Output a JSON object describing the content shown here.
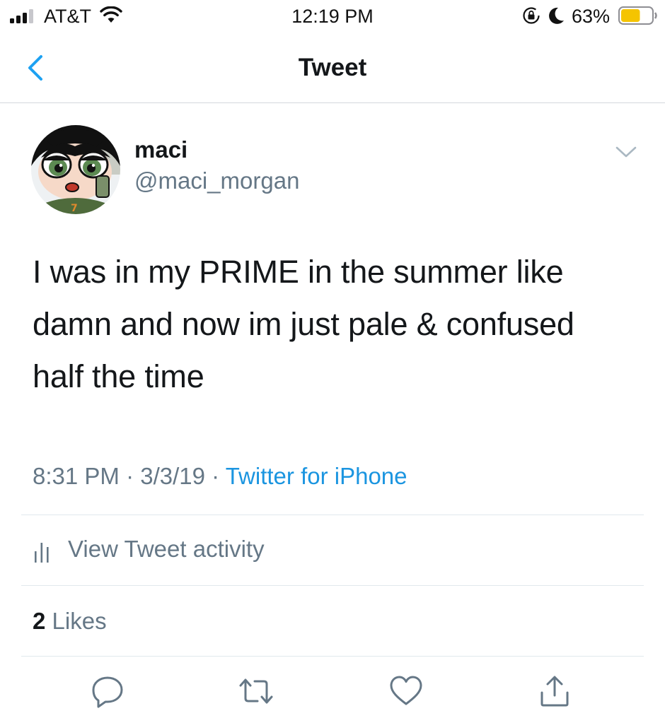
{
  "status_bar": {
    "carrier": "AT&T",
    "time": "12:19 PM",
    "battery_percent": "63%",
    "battery_level": 0.63,
    "icons": [
      "signal-icon",
      "wifi-icon",
      "rotation-lock-icon",
      "moon-icon",
      "battery-icon"
    ]
  },
  "nav": {
    "title": "Tweet",
    "back_icon": "chevron-left-icon"
  },
  "tweet": {
    "display_name": "maci",
    "handle": "@maci_morgan",
    "text": "I was in my PRIME in the summer like damn and now im just pale & confused half the time",
    "time": "8:31 PM",
    "separator": " · ",
    "date": "3/3/19",
    "source": "Twitter for iPhone"
  },
  "activity": {
    "label": "View Tweet activity",
    "icon": "bar-chart-icon"
  },
  "likes": {
    "count": "2",
    "label": "Likes"
  },
  "actions": {
    "icons": [
      "reply-icon",
      "retweet-icon",
      "like-icon",
      "share-icon"
    ]
  },
  "colors": {
    "accent": "#1b95e0",
    "text_primary": "#14171a",
    "text_secondary": "#657786",
    "divider": "#e1e8ed",
    "battery_fill": "#f5c400"
  }
}
